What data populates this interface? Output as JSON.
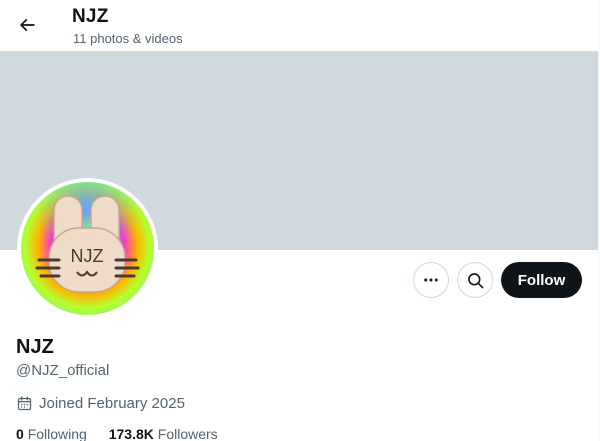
{
  "header": {
    "title": "NJZ",
    "subtitle": "11 photos & videos",
    "back_icon": "arrow-left-icon"
  },
  "profile": {
    "display_name": "NJZ",
    "handle": "@NJZ_official",
    "joined": "Joined February 2025",
    "banner_color": "#cfd9de",
    "avatar_text": "NJZ"
  },
  "actions": {
    "more_icon": "more-dots-icon",
    "search_icon": "search-icon",
    "follow_label": "Follow"
  },
  "stats": {
    "following_count": "0",
    "following_label": "Following",
    "followers_count": "173.8K",
    "followers_label": "Followers"
  },
  "colors": {
    "text": "#0f1419",
    "secondary": "#536471",
    "button": "#0f1419"
  }
}
